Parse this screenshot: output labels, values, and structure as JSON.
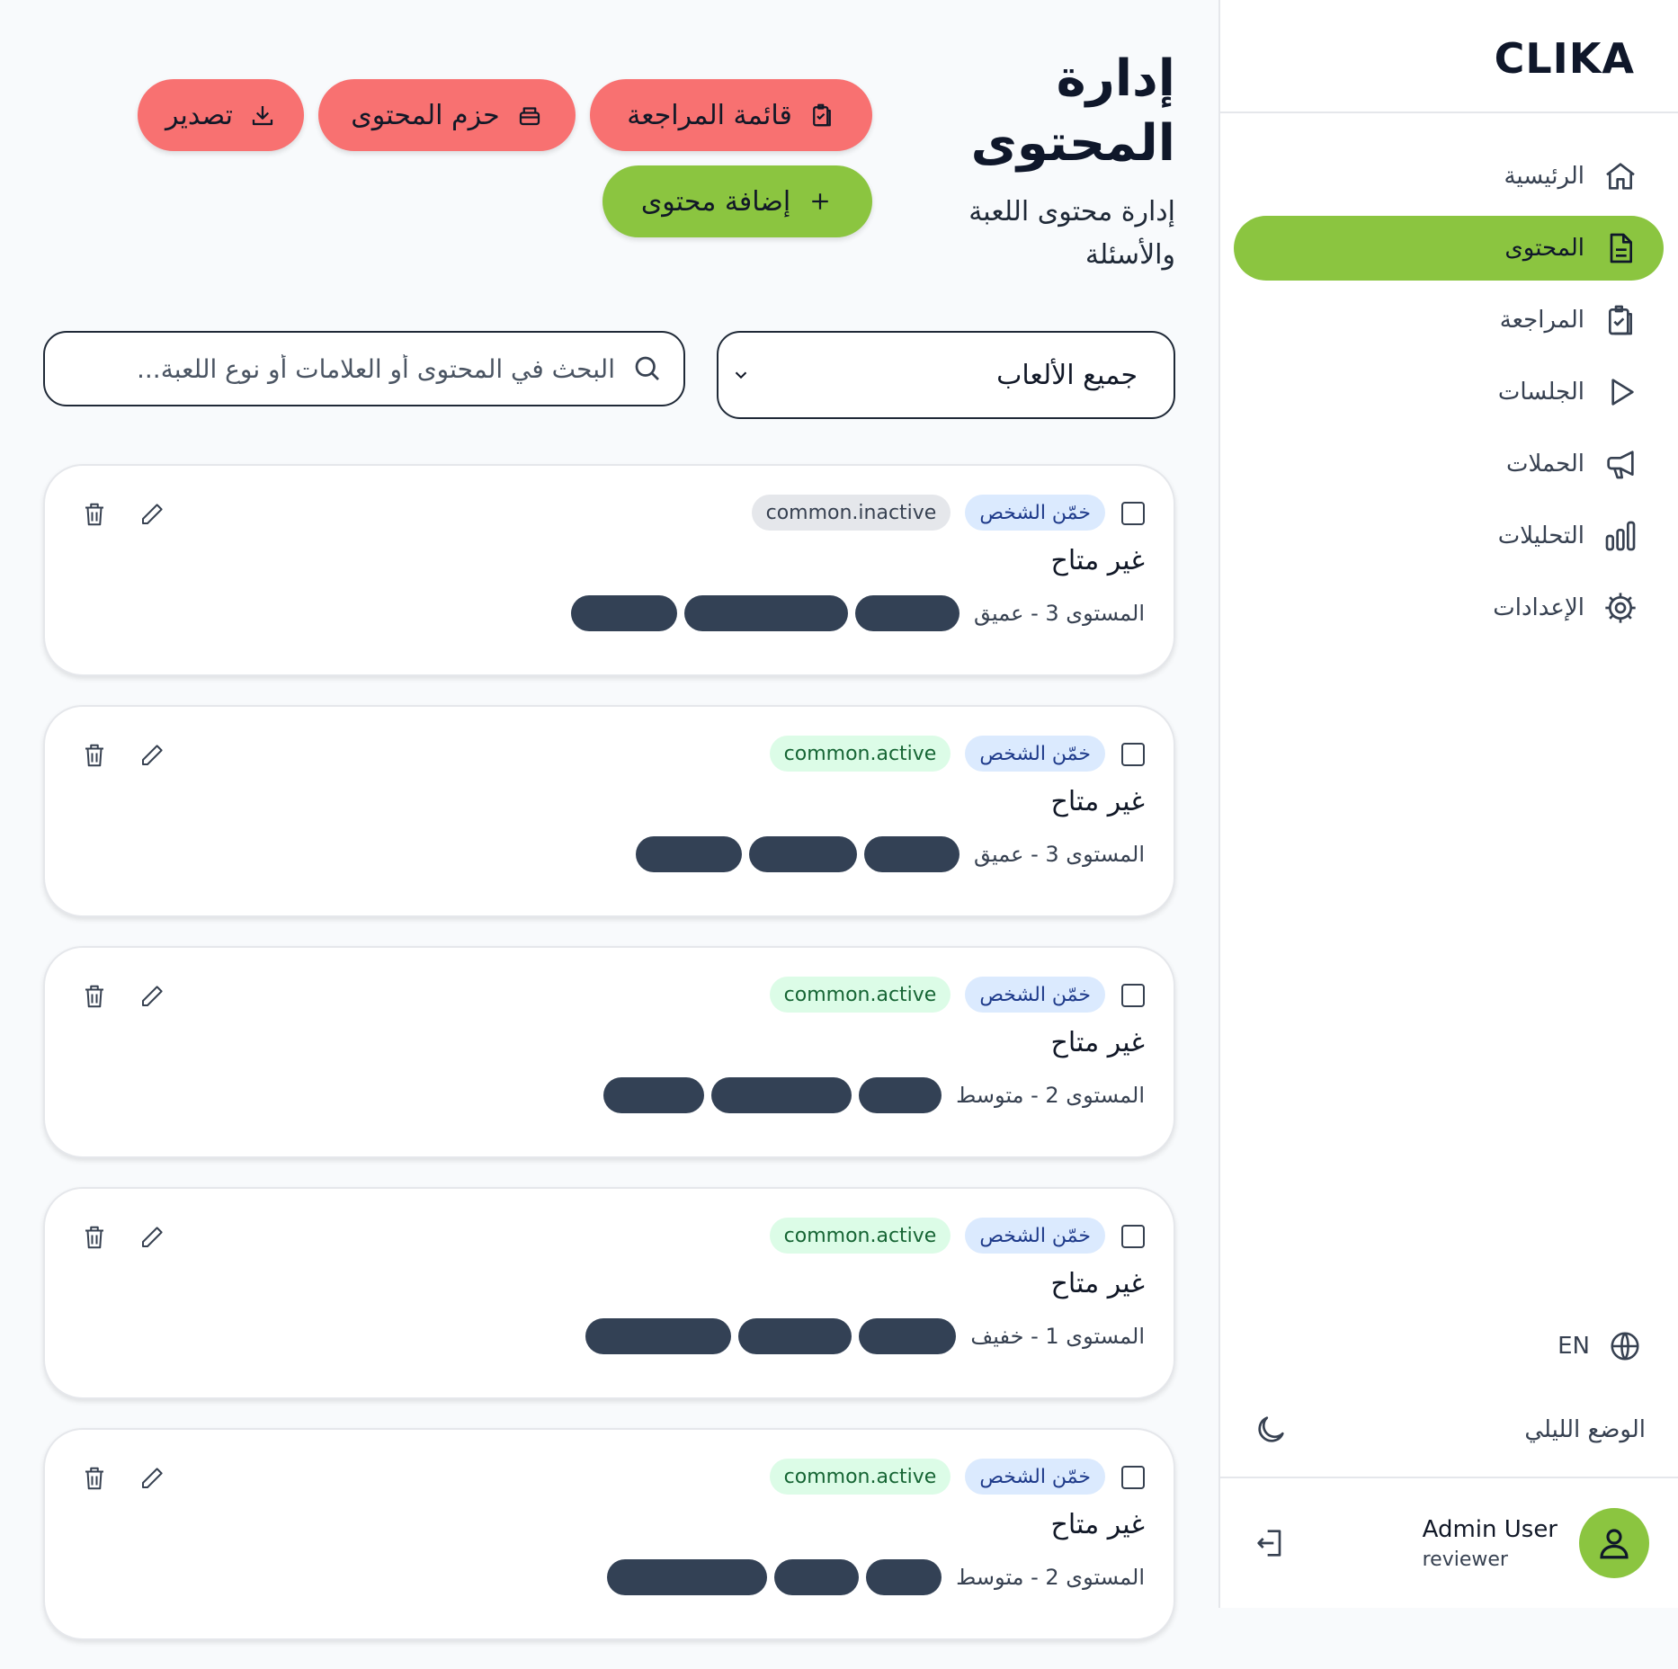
{
  "sidebar": {
    "brand": "CLIKA",
    "nav": [
      {
        "label": "الرئيسية",
        "icon": "home-icon",
        "active": false
      },
      {
        "label": "المحتوى",
        "icon": "document-icon",
        "active": true
      },
      {
        "label": "المراجعة",
        "icon": "clipboard-check-icon",
        "active": false
      },
      {
        "label": "الجلسات",
        "icon": "play-icon",
        "active": false
      },
      {
        "label": "الحملات",
        "icon": "megaphone-icon",
        "active": false
      },
      {
        "label": "التحليلات",
        "icon": "bar-chart-icon",
        "active": false
      },
      {
        "label": "الإعدادات",
        "icon": "gear-icon",
        "active": false
      }
    ],
    "language": "EN",
    "dark_mode": "الوضع الليلي",
    "user": {
      "name": "Admin User",
      "role": "reviewer"
    }
  },
  "header": {
    "title": "إدارة المحتوى",
    "subtitle": "إدارة محتوى اللعبة والأسئلة",
    "buttons": {
      "review_list": "قائمة المراجعة",
      "content_packs": "حزم المحتوى",
      "export": "تصدير",
      "add_content": "إضافة محتوى"
    }
  },
  "filters": {
    "game_select": "جميع الألعاب",
    "search_placeholder": "البحث في المحتوى أو العلامات أو نوع اللعبة..."
  },
  "content_items": [
    {
      "type": "خمّن الشخص",
      "status": "common.inactive",
      "title": "غير متاح",
      "level": "المستوى 3 - عميق",
      "tag_count": 3
    },
    {
      "type": "خمّن الشخص",
      "status": "common.active",
      "title": "غير متاح",
      "level": "المستوى 3 - عميق",
      "tag_count": 3
    },
    {
      "type": "خمّن الشخص",
      "status": "common.active",
      "title": "غير متاح",
      "level": "المستوى 2 - متوسط",
      "tag_count": 3
    },
    {
      "type": "خمّن الشخص",
      "status": "common.active",
      "title": "غير متاح",
      "level": "المستوى 1 - خفيف",
      "tag_count": 3
    },
    {
      "type": "خمّن الشخص",
      "status": "common.active",
      "title": "غير متاح",
      "level": "المستوى 2 - متوسط",
      "tag_count": 3
    }
  ],
  "colors": {
    "accent_green": "#8bc540",
    "button_red": "#f87171",
    "tag_dark": "#334155",
    "badge_blue": "#dbeafe",
    "badge_active": "#dcfce7",
    "badge_inactive": "#e5e7eb"
  }
}
